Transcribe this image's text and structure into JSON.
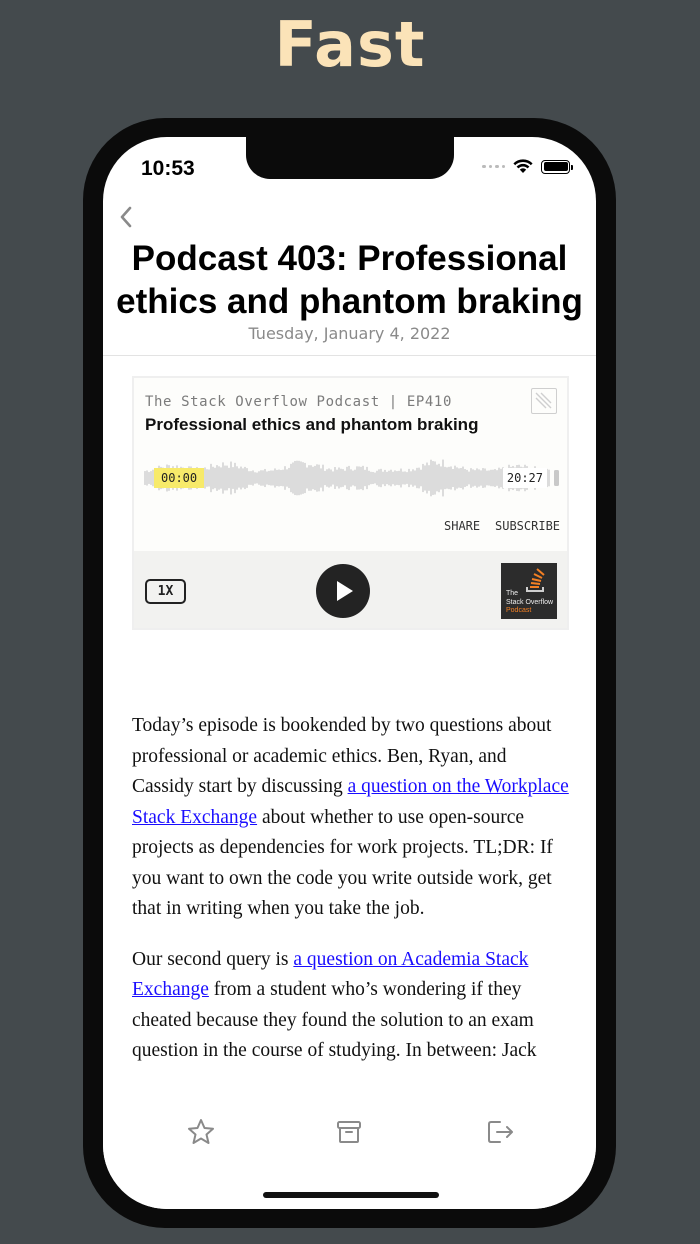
{
  "promo": {
    "title": "Fast"
  },
  "status_bar": {
    "time": "10:53"
  },
  "article": {
    "title": "Podcast 403: Professional ethics and phantom braking",
    "date": "Tuesday, January 4, 2022",
    "paragraphs": [
      {
        "before": "Today’s episode is bookended by two questions about professional or academic ethics. Ben, Ryan, and Cassidy start by discussing ",
        "link": "a question on the Workplace Stack Exchange",
        "after": " about whether to use open-source projects as dependencies for work projects. TL;DR: If you want to own the code you write outside work, get that in writing when you take the job."
      },
      {
        "before": "Our second query is ",
        "link": "a question on Academia Stack Exchange",
        "after": " from a student who’s wondering if they cheated because they found the solution to an exam question in the course of studying. In between: Jack"
      }
    ]
  },
  "player": {
    "series": "The Stack Overflow Podcast | EP410",
    "title": "Professional ethics and phantom braking",
    "time_current": "00:00",
    "time_total": "20:27",
    "share_label": "SHARE",
    "subscribe_label": "SUBSCRIBE",
    "speed_label": "1X",
    "cover": {
      "line1": "The",
      "line2": "Stack Overflow",
      "line3": "Podcast"
    },
    "accent_color": "#f48024",
    "highlight_color": "#f7ea6a"
  },
  "toolbar": {
    "icons": [
      "star-icon",
      "archive-icon",
      "share-out-icon"
    ]
  },
  "colors": {
    "background": "#444a4d",
    "promo_title": "#fbe3b8",
    "link": "#1a0dff"
  }
}
